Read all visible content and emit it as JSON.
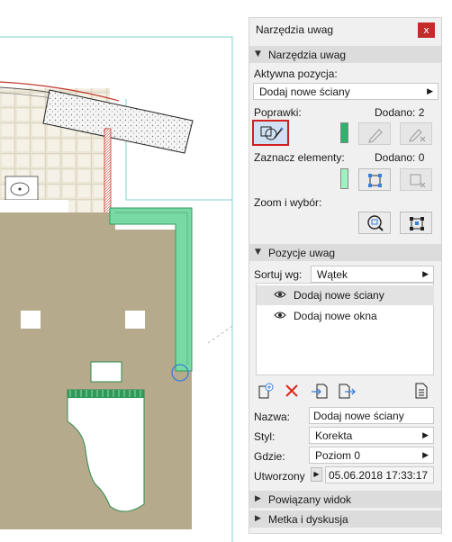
{
  "palette": {
    "title": "Narzędzia uwag",
    "close_symbol": "x",
    "tools_section": {
      "title": "Narzędzia uwag",
      "active_label": "Aktywna pozycja:",
      "active_value": "Dodaj nowe ściany",
      "corrections_label": "Poprawki:",
      "corrections_count": "Dodano: 2",
      "select_label": "Zaznacz elementy:",
      "select_count": "Dodano: 0",
      "zoom_label": "Zoom i wybór:",
      "corrections_color": "#2db36b",
      "select_color": "#9ef2c0"
    },
    "items_section": {
      "title": "Pozycje uwag",
      "sort_label": "Sortuj wg:",
      "sort_value": "Wątek",
      "items": [
        {
          "label": "Dodaj nowe ściany",
          "selected": true
        },
        {
          "label": "Dodaj nowe okna",
          "selected": false
        }
      ]
    },
    "details": {
      "name_label": "Nazwa:",
      "name_value": "Dodaj nowe ściany",
      "style_label": "Styl:",
      "style_value": "Korekta",
      "where_label": "Gdzie:",
      "where_value": "Poziom 0",
      "created_label": "Utworzony",
      "created_value": "05.06.2018 17:33:17"
    },
    "linked_view_section": "Powiązany widok",
    "tag_section": "Metka i dyskusja"
  },
  "colors": {
    "floor": "#b5ab8c",
    "highlight_wall": "#79d9a4",
    "selection_red": "#d1201f",
    "accent_blue": "#3a7fd8"
  },
  "icons": {
    "section_expanded": "triangle-down",
    "section_collapsed": "triangle-right",
    "dropdown": "triangle-right"
  }
}
